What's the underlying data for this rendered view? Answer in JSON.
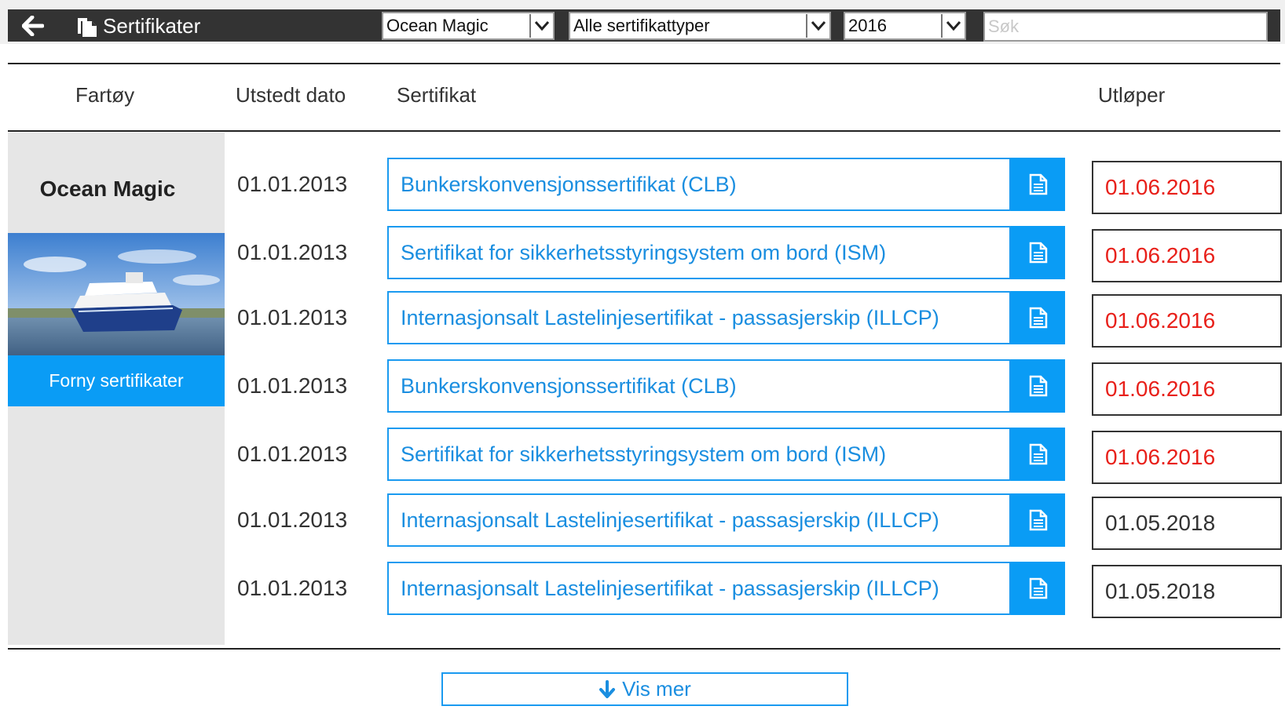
{
  "topbar": {
    "title": "Sertifikater",
    "vessel_select": "Ocean Magic",
    "type_select": "Alle sertifikattyper",
    "year_select": "2016",
    "search_placeholder": "Søk"
  },
  "columns": {
    "vessel": "Fartøy",
    "issued": "Utstedt dato",
    "certificate": "Sertifikat",
    "expires": "Utløper"
  },
  "vessel": {
    "name": "Ocean Magic",
    "renew_label": "Forny sertifikater"
  },
  "rows": [
    {
      "issued": "01.01.2013",
      "certificate": "Bunkerskonvensjonssertifikat (CLB)",
      "expires": "01.06.2016",
      "expired": true
    },
    {
      "issued": "01.01.2013",
      "certificate": "Sertifikat for sikkerhetsstyringsystem om bord (ISM)",
      "expires": "01.06.2016",
      "expired": true
    },
    {
      "issued": "01.01.2013",
      "certificate": "Internasjonsalt Lastelinjesertifikat - passasjerskip (ILLCP)",
      "expires": "01.06.2016",
      "expired": true
    },
    {
      "issued": "01.01.2013",
      "certificate": "Bunkerskonvensjonssertifikat (CLB)",
      "expires": "01.06.2016",
      "expired": true
    },
    {
      "issued": "01.01.2013",
      "certificate": "Sertifikat for sikkerhetsstyringsystem om bord (ISM)",
      "expires": "01.06.2016",
      "expired": true
    },
    {
      "issued": "01.01.2013",
      "certificate": "Internasjonsalt Lastelinjesertifikat - passasjerskip (ILLCP)",
      "expires": "01.05.2018",
      "expired": false
    },
    {
      "issued": "01.01.2013",
      "certificate": "Internasjonsalt Lastelinjesertifikat - passasjerskip (ILLCP)",
      "expires": "01.05.2018",
      "expired": false
    }
  ],
  "more_label": "Vis mer",
  "colors": {
    "accent": "#0a9cf5",
    "link": "#1a8ee0",
    "expired": "#e8201a",
    "topbar": "#333333"
  },
  "icons": {
    "back": "arrow-left-icon",
    "title": "documents-icon",
    "dropdown": "chevron-down-icon",
    "doc": "document-icon",
    "more": "arrow-down-icon"
  }
}
